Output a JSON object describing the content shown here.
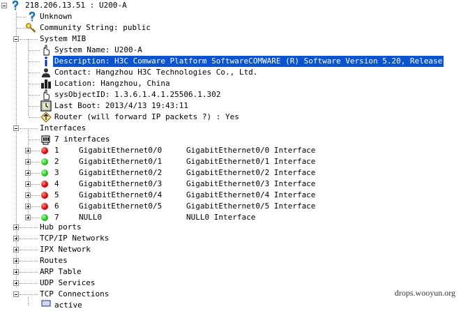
{
  "tree": {
    "root": "218.206.13.51  : U200-A",
    "unknown": "Unknown",
    "community": "Community String: public",
    "system_mib": {
      "label": "System MIB",
      "items": {
        "name": "System Name: U200-A",
        "description": "Description: H3C Comware Platform SoftwareCOMWARE (R) Software Version 5.20, Release",
        "contact": "Contact: Hangzhou H3C Technologies Co., Ltd.",
        "location": "Location: Hangzhou, China",
        "objectid": "sysObjectID: 1.3.6.1.4.1.25506.1.302",
        "lastboot": "Last Boot: 2013/4/13 19:43:11",
        "router": "Router (will forward IP packets ?) : Yes"
      }
    },
    "interfaces": {
      "label": "Interfaces",
      "count_label": "7 interfaces",
      "rows": [
        {
          "num": "1",
          "name": "GigabitEthernet0/0",
          "desc": "GigabitEthernet0/0 Interface",
          "status": "down"
        },
        {
          "num": "2",
          "name": "GigabitEthernet0/1",
          "desc": "GigabitEthernet0/1 Interface",
          "status": "up"
        },
        {
          "num": "3",
          "name": "GigabitEthernet0/2",
          "desc": "GigabitEthernet0/2 Interface",
          "status": "up"
        },
        {
          "num": "4",
          "name": "GigabitEthernet0/3",
          "desc": "GigabitEthernet0/3 Interface",
          "status": "down"
        },
        {
          "num": "5",
          "name": "GigabitEthernet0/4",
          "desc": "GigabitEthernet0/4 Interface",
          "status": "down"
        },
        {
          "num": "6",
          "name": "GigabitEthernet0/5",
          "desc": "GigabitEthernet0/5 Interface",
          "status": "down"
        },
        {
          "num": "7",
          "name": "NULL0",
          "desc": "NULL0 Interface",
          "status": "up"
        }
      ]
    },
    "groups": {
      "hub": "Hub ports",
      "tcpip": "TCP/IP Networks",
      "ipx": "IPX Network",
      "routes": "Routes",
      "arp": "ARP Table",
      "udp": "UDP Services",
      "tcp": "TCP Connections",
      "active": "active"
    }
  },
  "colors": {
    "selection": "#0a54d0",
    "status_up": "#1fbf1f",
    "status_down": "#d00000"
  },
  "watermark": "drops.wooyun.org"
}
